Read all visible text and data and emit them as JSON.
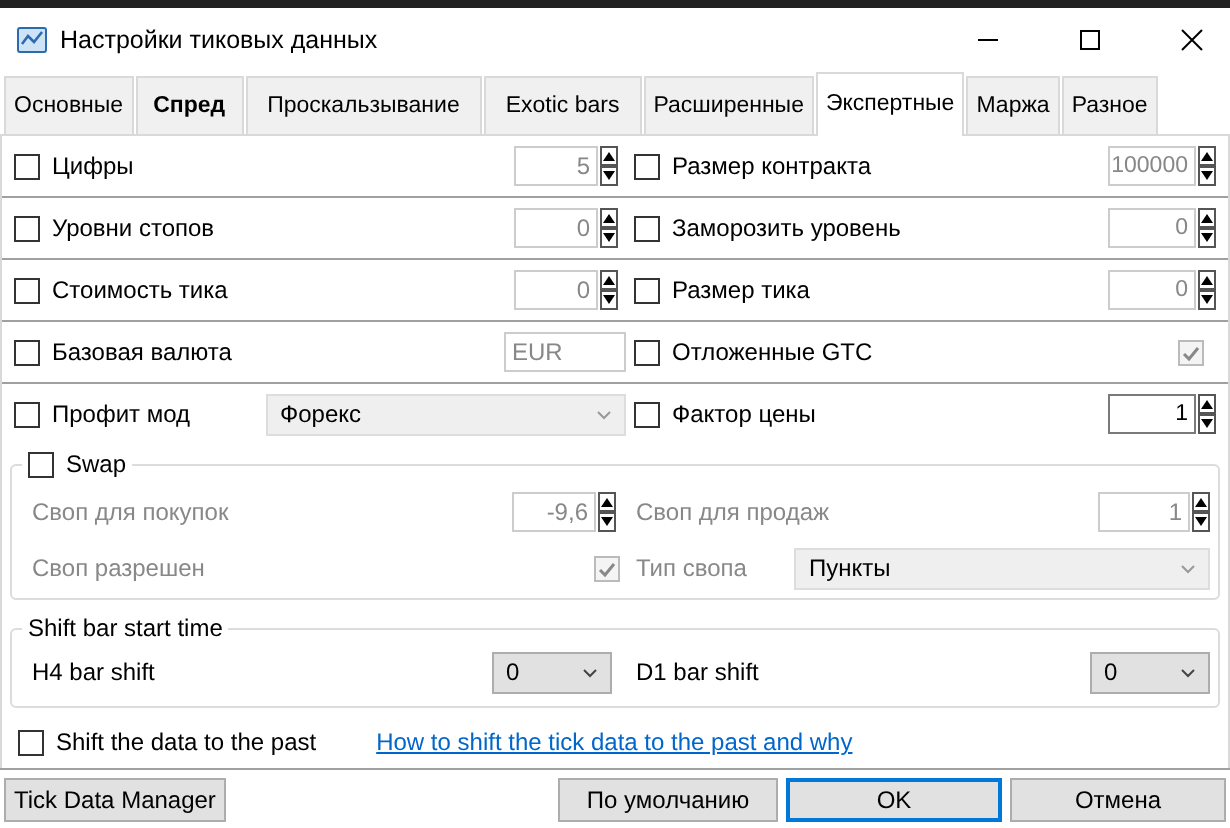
{
  "window": {
    "title": "Настройки тиковых данных"
  },
  "tabs": [
    {
      "label": "Основные",
      "selected": false,
      "bold": false
    },
    {
      "label": "Спред",
      "selected": false,
      "bold": true
    },
    {
      "label": "Проскальзывание",
      "selected": false,
      "bold": false
    },
    {
      "label": "Exotic bars",
      "selected": false,
      "bold": false
    },
    {
      "label": "Расширенные",
      "selected": false,
      "bold": false
    },
    {
      "label": "Экспертные",
      "selected": true,
      "bold": false
    },
    {
      "label": "Маржа",
      "selected": false,
      "bold": false
    },
    {
      "label": "Разное",
      "selected": false,
      "bold": false
    }
  ],
  "rows": [
    [
      {
        "label": "Цифры",
        "checked": false,
        "control": {
          "kind": "spin",
          "value": "5",
          "disabled": true
        }
      },
      {
        "label": "Размер контракта",
        "checked": false,
        "control": {
          "kind": "spin",
          "value": "100000",
          "disabled": true
        }
      }
    ],
    [
      {
        "label": "Уровни стопов",
        "checked": false,
        "control": {
          "kind": "spin",
          "value": "0",
          "disabled": true
        }
      },
      {
        "label": "Заморозить уровень",
        "checked": false,
        "control": {
          "kind": "spin",
          "value": "0",
          "disabled": true
        }
      }
    ],
    [
      {
        "label": "Стоимость тика",
        "checked": false,
        "control": {
          "kind": "spin",
          "value": "0",
          "disabled": true
        }
      },
      {
        "label": "Размер тика",
        "checked": false,
        "control": {
          "kind": "spin",
          "value": "0",
          "disabled": true
        }
      }
    ],
    [
      {
        "label": "Базовая валюта",
        "checked": false,
        "control": {
          "kind": "text",
          "value": "EUR",
          "disabled": true
        }
      },
      {
        "label": "Отложенные GTC",
        "checked": false,
        "control": {
          "kind": "checkbox",
          "checked": true,
          "disabled": true
        }
      }
    ],
    [
      {
        "label": "Профит мод",
        "checked": false,
        "control": {
          "kind": "select",
          "value": "Форекс",
          "disabled": true
        }
      },
      {
        "label": "Фактор цены",
        "checked": false,
        "control": {
          "kind": "spin",
          "value": "1",
          "disabled": false
        }
      }
    ]
  ],
  "swap": {
    "label": "Swap",
    "checked": false,
    "fields": [
      {
        "label": "Своп для покупок",
        "control": {
          "kind": "spin",
          "value": "-9,6",
          "disabled": true
        }
      },
      {
        "label": "Своп для продаж",
        "control": {
          "kind": "spin",
          "value": "1",
          "disabled": true
        }
      },
      {
        "label": "Своп разрешен",
        "control": {
          "kind": "checkbox",
          "checked": true,
          "disabled": true
        }
      },
      {
        "label": "Тип свопа",
        "control": {
          "kind": "select",
          "value": "Пункты",
          "disabled": true
        }
      }
    ]
  },
  "shift": {
    "title": "Shift bar start time",
    "fields": [
      {
        "label": "H4 bar shift",
        "control": {
          "kind": "select",
          "value": "0",
          "disabled": false
        }
      },
      {
        "label": "D1 bar shift",
        "control": {
          "kind": "select",
          "value": "0",
          "disabled": false
        }
      }
    ]
  },
  "past": {
    "label": "Shift the data to the past",
    "checked": false,
    "link": "How to shift the tick data to the past and why"
  },
  "buttons": [
    {
      "label": "Tick Data Manager",
      "default": false
    },
    {
      "label": "По умолчанию",
      "default": false
    },
    {
      "label": "OK",
      "default": true
    },
    {
      "label": "Отмена",
      "default": false
    }
  ]
}
